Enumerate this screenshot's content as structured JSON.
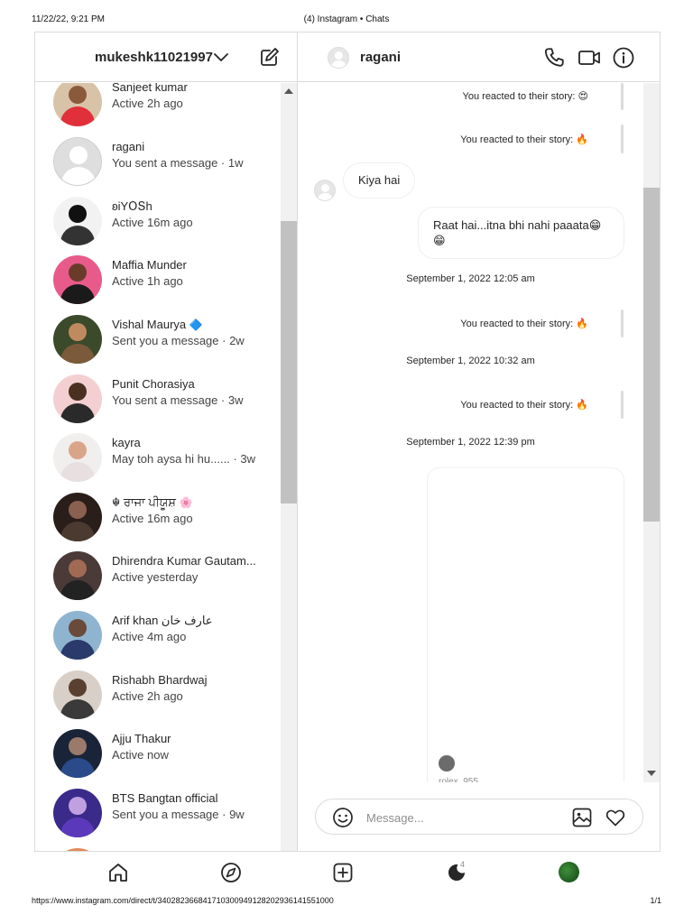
{
  "print": {
    "timestamp": "11/22/22, 9:21 PM",
    "title": "(4) Instagram • Chats",
    "url": "https://www.instagram.com/direct/t/340282366841710300949128202936141551000",
    "page": "1/1"
  },
  "sidebar": {
    "username": "mukeshk11021997",
    "icons": {
      "chevron": "chevron-down-icon",
      "compose": "compose-icon"
    },
    "chats": [
      {
        "name": "Sanjeet kumar",
        "status": "Active 2h ago"
      },
      {
        "name": "ragani",
        "status": "You sent a message · 1w"
      },
      {
        "name": "ʚiYՕՏh",
        "status": "Active 16m ago"
      },
      {
        "name": "Maffia Munder",
        "status": "Active 1h ago"
      },
      {
        "name": "Vishal Maurya",
        "badge": "🔷",
        "status": "Sent you a message · 2w"
      },
      {
        "name": "Punit Chorasiya",
        "status": "You sent a message · 3w"
      },
      {
        "name": "kayra",
        "status": "May toh aysa hi hu......  · 3w"
      },
      {
        "name": "☬ ਰਾਜਾ ਪੀਯੂਸ਼",
        "badge": "🌸",
        "status": "Active 16m ago"
      },
      {
        "name": "Dhirendra Kumar Gautam...",
        "status": "Active yesterday"
      },
      {
        "name": "Arif khan عارف خان",
        "status": "Active 4m ago"
      },
      {
        "name": "Rishabh Bhardwaj",
        "status": "Active 2h ago"
      },
      {
        "name": "Ajju Thakur",
        "status": "Active now"
      },
      {
        "name": "BTS Bangtan official",
        "status": "Sent you a message · 9w"
      }
    ]
  },
  "conversation": {
    "peer_name": "ragani",
    "header_icons": [
      "phone-icon",
      "video-icon",
      "info-icon"
    ],
    "messages": [
      {
        "kind": "reaction",
        "text": "You reacted to their story: 😍"
      },
      {
        "kind": "reaction",
        "text": "You reacted to their story: 🔥"
      },
      {
        "kind": "incoming",
        "text": "Kiya hai"
      },
      {
        "kind": "outgoing",
        "text": "Raat hai...itna bhi nahi paaata😁",
        "text2": "😁"
      },
      {
        "kind": "date",
        "text": "September 1, 2022 12:05 am"
      },
      {
        "kind": "reaction",
        "text": "You reacted to their story: 🔥"
      },
      {
        "kind": "date",
        "text": "September 1, 2022 10:32 am"
      },
      {
        "kind": "reaction",
        "text": "You reacted to their story: 🔥"
      },
      {
        "kind": "date",
        "text": "September 1, 2022 12:39 pm"
      },
      {
        "kind": "media",
        "caption": "rolex_955"
      }
    ],
    "composer": {
      "placeholder": "Message...",
      "value": ""
    }
  },
  "bottom_nav": {
    "items": [
      "home-icon",
      "explore-icon",
      "new-post-icon",
      "activity-icon",
      "profile-avatar"
    ],
    "activity_count": "4"
  },
  "colors": {
    "border": "#dbdbdb",
    "text": "#262626",
    "muted": "#8e8e8e",
    "scroll_thumb": "#c1c1c1"
  }
}
